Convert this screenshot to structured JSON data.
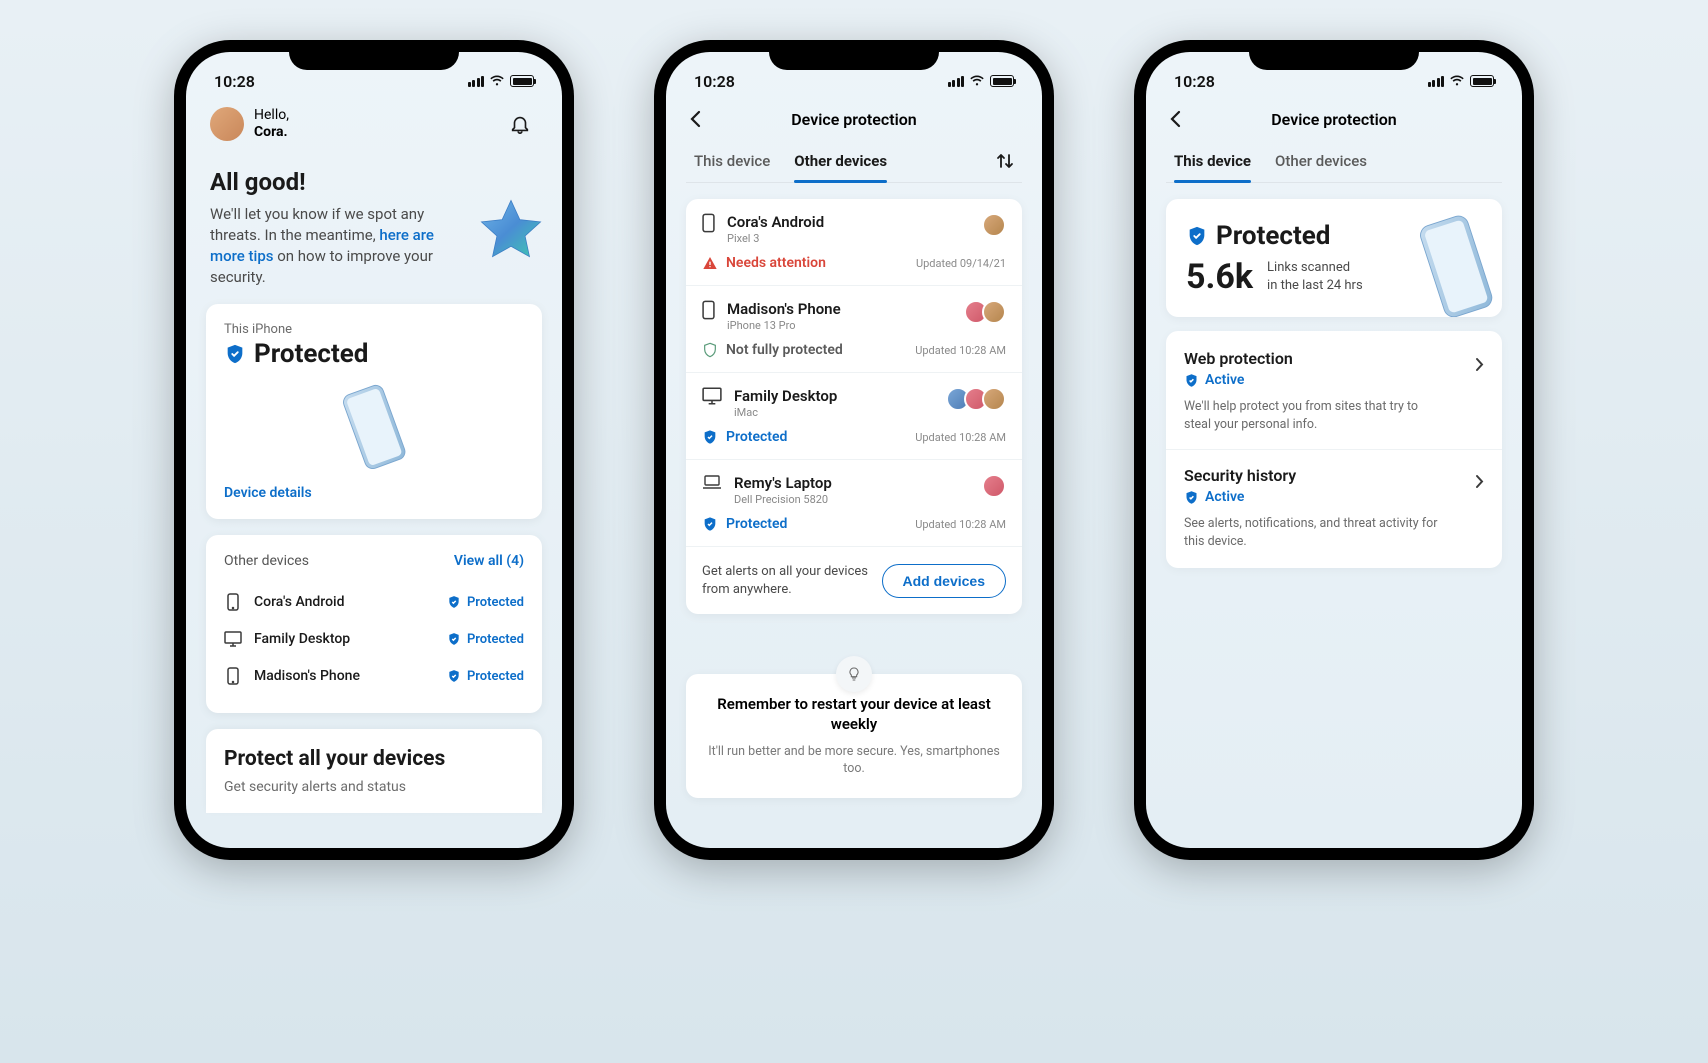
{
  "status_bar": {
    "time": "10:28"
  },
  "screen1": {
    "greeting": "Hello,",
    "name": "Cora.",
    "title": "All good!",
    "subtitle_pre": "We'll let you know if we spot any threats. In the meantime, ",
    "subtitle_link": "here are more tips",
    "subtitle_post": " on how to improve your security.",
    "this_device_label": "This iPhone",
    "this_device_status": "Protected",
    "device_details": "Device details",
    "other_devices_label": "Other devices",
    "view_all": "View all (4)",
    "other_devices": [
      {
        "name": "Cora's Android",
        "status": "Protected",
        "icon": "phone"
      },
      {
        "name": "Family Desktop",
        "status": "Protected",
        "icon": "desktop"
      },
      {
        "name": "Madison's Phone",
        "status": "Protected",
        "icon": "phone"
      }
    ],
    "banner_title": "Protect all your devices",
    "banner_sub": "Get security alerts and status"
  },
  "screen2": {
    "title": "Device protection",
    "tab1": "This device",
    "tab2": "Other devices",
    "devices": [
      {
        "name": "Cora's Android",
        "model": "Pixel 3",
        "status": "Needs attention",
        "status_type": "warn",
        "updated": "Updated 09/14/21",
        "icon": "phone",
        "avatars": 1
      },
      {
        "name": "Madison's Phone",
        "model": "iPhone 13 Pro",
        "status": "Not fully protected",
        "status_type": "partial",
        "updated": "Updated 10:28 AM",
        "icon": "phone",
        "avatars": 2
      },
      {
        "name": "Family Desktop",
        "model": "iMac",
        "status": "Protected",
        "status_type": "ok",
        "updated": "Updated 10:28 AM",
        "icon": "desktop",
        "avatars": 3
      },
      {
        "name": "Remy's Laptop",
        "model": "Dell Precision 5820",
        "status": "Protected",
        "status_type": "ok",
        "updated": "Updated 10:28 AM",
        "icon": "laptop",
        "avatars": 1
      }
    ],
    "footer_text": "Get alerts on all your devices from anywhere.",
    "add_button": "Add devices",
    "tip_title": "Remember to restart your device at least weekly",
    "tip_sub": "It'll run better and be more secure. Yes, smartphones too."
  },
  "screen3": {
    "title": "Device protection",
    "tab1": "This device",
    "tab2": "Other devices",
    "status": "Protected",
    "stat_num": "5.6k",
    "stat_label_1": "Links scanned",
    "stat_label_2": "in the last 24 hrs",
    "section1_title": "Web protection",
    "section1_status": "Active",
    "section1_desc": "We'll help protect you from sites that try to steal your personal info.",
    "section2_title": "Security history",
    "section2_status": "Active",
    "section2_desc": "See alerts, notifications, and threat activity for this device."
  }
}
